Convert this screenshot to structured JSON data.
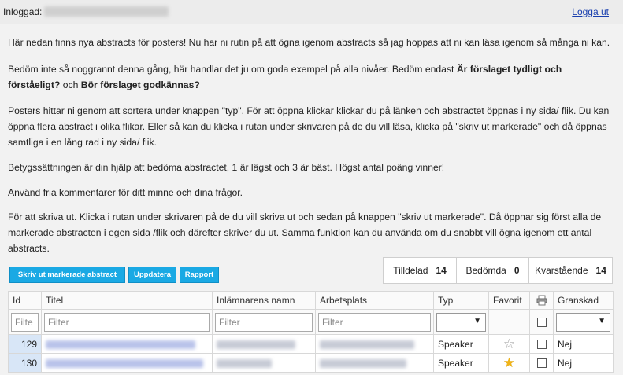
{
  "header": {
    "logged_in_label": "Inloggad:",
    "logout_link": "Logga ut"
  },
  "intro": {
    "p1": "Här nedan finns nya abstracts för posters! Nu har ni rutin på att ögna igenom abstracts så jag hoppas att ni kan läsa igenom så många ni kan.",
    "p2_a": "Bedöm inte så noggrannt denna gång, här handlar det ju om goda exempel på alla nivåer. Bedöm endast ",
    "p2_b": "Är förslaget tydligt och förståeligt?",
    "p2_c": " och ",
    "p2_d": "Bör förslaget godkännas?",
    "p3": "Posters hittar ni genom att sortera under knappen \"typ\". För att öppna klickar klickar du på länken och abstractet öppnas i ny sida/ flik. Du kan öppna flera abstract i olika flikar. Eller så kan du klicka i rutan under skrivaren på de du vill läsa, klicka på \"skriv ut markerade\" och då öppnas samtliga i en lång rad i ny sida/ flik.",
    "p4": "Betygssättningen är din hjälp att bedöma abstractet, 1 är lägst och 3 är bäst. Högst antal poäng vinner!",
    "p5": "Använd fria kommentarer för ditt minne och dina frågor.",
    "p6": "För att skriva ut. Klicka i rutan under skrivaren på de du vill skriva ut och sedan på knappen \"skriv ut markerade\". Då öppnar sig först alla de markerade abstracten i egen sida /flik och därefter skriver du ut.  Samma funktion kan du använda om du snabbt vill ögna igenom ett antal abstracts."
  },
  "toolbar": {
    "print_selected": "Skriv ut markerade abstract",
    "update": "Uppdatera",
    "report": "Rapport"
  },
  "stats": {
    "assigned_label": "Tilldelad",
    "assigned_value": "14",
    "reviewed_label": "Bedömda",
    "reviewed_value": "0",
    "remaining_label": "Kvarstående",
    "remaining_value": "14"
  },
  "table": {
    "columns": {
      "id": "Id",
      "title": "Titel",
      "submitter": "Inlämnarens namn",
      "workplace": "Arbetsplats",
      "type": "Typ",
      "favorite": "Favorit",
      "reviewed": "Granskad"
    },
    "filter_placeholder": "Filter",
    "id_filter_placeholder": "Filte",
    "rows": [
      {
        "id": "129",
        "type": "Speaker",
        "favorite": false,
        "reviewed": "Nej"
      },
      {
        "id": "130",
        "type": "Speaker",
        "favorite": true,
        "reviewed": "Nej"
      }
    ]
  },
  "colors": {
    "button": "#1aa9e4",
    "link": "#1a3fae",
    "star_active": "#f0b418",
    "id_cell": "#d8e6f7"
  },
  "icons": {
    "printer": "printer-icon",
    "star": "star-icon",
    "dropdown": "chevron-down-icon"
  }
}
